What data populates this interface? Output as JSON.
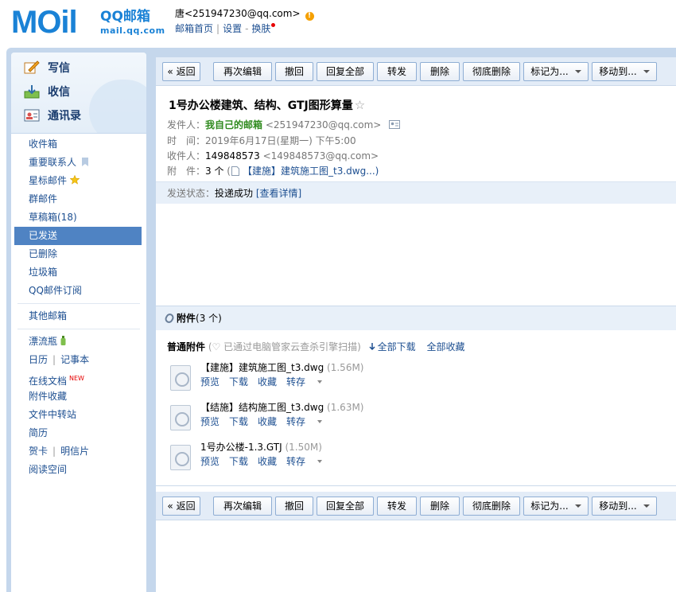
{
  "header": {
    "logo_text": "MOil",
    "logo_brand": "QQ邮箱",
    "logo_domain": "mail.qq.com",
    "user": "唐<251947230@qq.com>",
    "links": [
      "邮箱首页",
      "设置",
      "换肤"
    ]
  },
  "quick": {
    "compose": "写信",
    "inbox": "收信",
    "contacts": "通讯录"
  },
  "nav": {
    "items": [
      "收件箱",
      "重要联系人",
      "星标邮件",
      "群邮件",
      "草稿箱(18)",
      "已发送",
      "已删除",
      "垃圾箱",
      "QQ邮件订阅"
    ],
    "other": "其他邮箱",
    "apps": [
      "漂流瓶",
      "日历",
      "记事本",
      "在线文档",
      "附件收藏",
      "文件中转站",
      "简历",
      "贺卡",
      "明信片",
      "阅读空间"
    ],
    "new_badge": "NEW",
    "active": "已发送"
  },
  "toolbar": {
    "back": "« 返回",
    "reedit": "再次编辑",
    "recall": "撤回",
    "reply_all": "回复全部",
    "forward": "转发",
    "delete": "删除",
    "delete_forever": "彻底删除",
    "mark_as": "标记为...",
    "move_to": "移动到..."
  },
  "mail": {
    "subject": "1号办公楼建筑、结构、GTJ图形算量",
    "star": "☆",
    "from_label": "发件人：",
    "from_name": "我自己的邮箱",
    "from_addr": "<251947230@qq.com>",
    "time_label": "时　间：",
    "time": "2019年6月17日(星期一) 下午5:00",
    "to_label": "收件人：",
    "to_name": "149848573",
    "to_addr": "<149848573@qq.com>",
    "attach_label": "附　件：",
    "attach_count": "3 个",
    "attach_preview": "【建施】建筑施工图_t3.dwg...)",
    "status_label": "发送状态：",
    "status_value": "投递成功",
    "status_link": "[查看详情]"
  },
  "attachments": {
    "header": "附件",
    "count": "(3 个)",
    "normal_label": "普通附件",
    "scan_note": "(♡ 已通过电脑管家云查杀引擎扫描)",
    "download_all": "全部下载",
    "save_all": "全部收藏",
    "actions": [
      "预览",
      "下载",
      "收藏",
      "转存"
    ],
    "files": [
      {
        "name": "【建施】建筑施工图_t3.dwg",
        "size": "(1.56M)"
      },
      {
        "name": "【结施】结构施工图_t3.dwg",
        "size": "(1.63M)"
      },
      {
        "name": "1号办公楼-1.3.GTJ",
        "size": "(1.50M)"
      }
    ]
  }
}
